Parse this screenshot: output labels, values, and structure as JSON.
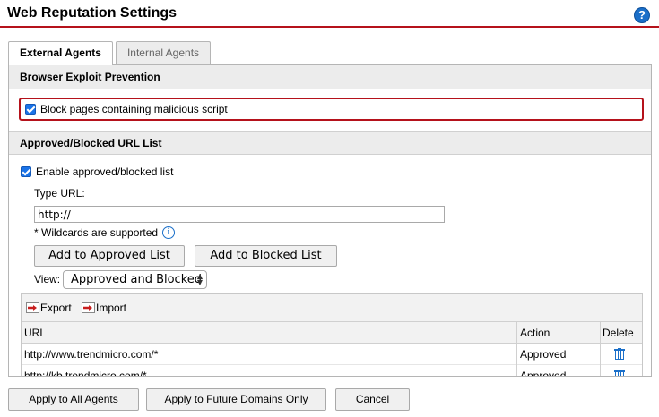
{
  "header": {
    "title": "Web Reputation Settings",
    "help_icon": "?"
  },
  "tabs": [
    {
      "label": "External Agents",
      "active": true
    },
    {
      "label": "Internal Agents",
      "active": false
    }
  ],
  "browser_exploit": {
    "section_title": "Browser Exploit Prevention",
    "block_malicious_label": "Block pages containing malicious script",
    "block_malicious_checked": true
  },
  "url_list": {
    "section_title": "Approved/Blocked URL List",
    "enable_label": "Enable approved/blocked list",
    "enable_checked": true,
    "type_url_label": "Type URL:",
    "url_value": "http://",
    "wildcard_note": "* Wildcards are supported",
    "info_icon": "i",
    "add_approved_label": "Add to Approved List",
    "add_blocked_label": "Add to Blocked List",
    "view_label": "View:",
    "view_selected": "Approved and Blocked",
    "toolbar": {
      "export_label": "Export",
      "import_label": "Import"
    },
    "columns": {
      "url": "URL",
      "action": "Action",
      "delete": "Delete"
    },
    "rows": [
      {
        "url": "http://www.trendmicro.com/*",
        "action": "Approved"
      },
      {
        "url": "http://kb.trendmicro.com/*",
        "action": "Approved"
      }
    ]
  },
  "footer": {
    "apply_all_label": "Apply to All Agents",
    "apply_future_label": "Apply to Future Domains Only",
    "cancel_label": "Cancel"
  },
  "colors": {
    "accent_red": "#b5121b",
    "checkbox_blue": "#1a73e8",
    "icon_blue": "#1a6fc9"
  }
}
